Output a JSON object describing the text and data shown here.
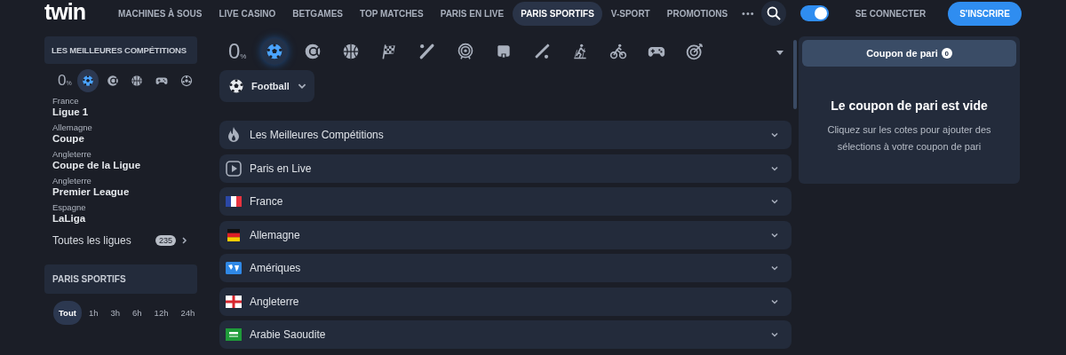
{
  "header": {
    "logo": "twin",
    "nav": [
      {
        "label": "MACHINES À SOUS",
        "selected": false
      },
      {
        "label": "LIVE CASINO",
        "selected": false
      },
      {
        "label": "BETGAMES",
        "selected": false
      },
      {
        "label": "TOP MATCHES",
        "selected": false
      },
      {
        "label": "PARIS EN LIVE",
        "selected": false
      },
      {
        "label": "PARIS SPORTIFS",
        "selected": true
      },
      {
        "label": "V-SPORT",
        "selected": false
      },
      {
        "label": "PROMOTIONS",
        "selected": false
      }
    ],
    "more": "•••",
    "dark_mode": {
      "on": true
    },
    "login": "SE CONNECTER",
    "signup": "S'INSCRIRE"
  },
  "sidebar": {
    "title": "LES MEILLEURES COMPÉTITIONS",
    "sports": [
      {
        "kind": "zero",
        "digit": "0",
        "sign": "%",
        "selected": false
      },
      {
        "kind": "football",
        "selected": true
      },
      {
        "kind": "tennis",
        "selected": false
      },
      {
        "kind": "basketball",
        "selected": false
      },
      {
        "kind": "gamepad",
        "selected": false
      },
      {
        "kind": "ball",
        "selected": false
      }
    ],
    "leagues": [
      {
        "country": "France",
        "name": "Ligue 1"
      },
      {
        "country": "Allemagne",
        "name": "Coupe"
      },
      {
        "country": "Angleterre",
        "name": "Coupe de la Ligue"
      },
      {
        "country": "Angleterre",
        "name": "Premier League"
      },
      {
        "country": "Espagne",
        "name": "LaLiga"
      }
    ],
    "all_leagues": {
      "label": "Toutes les ligues",
      "count": "235"
    },
    "section": "PARIS SPORTIFS",
    "time_filters": [
      {
        "label": "Tout",
        "selected": true
      },
      {
        "label": "1h",
        "selected": false
      },
      {
        "label": "3h",
        "selected": false
      },
      {
        "label": "6h",
        "selected": false
      },
      {
        "label": "12h",
        "selected": false
      },
      {
        "label": "24h",
        "selected": false
      }
    ]
  },
  "main": {
    "sports": [
      {
        "kind": "zero",
        "digit": "0",
        "sign": "%",
        "selected": false
      },
      {
        "kind": "football",
        "selected": true
      },
      {
        "kind": "tennis",
        "selected": false
      },
      {
        "kind": "basketball",
        "selected": false
      },
      {
        "kind": "flag",
        "selected": false
      },
      {
        "kind": "baseball",
        "selected": false
      },
      {
        "kind": "target",
        "selected": false
      },
      {
        "kind": "boxing",
        "selected": false
      },
      {
        "kind": "cricket",
        "selected": false
      },
      {
        "kind": "skiing",
        "selected": false
      },
      {
        "kind": "cycling",
        "selected": false
      },
      {
        "kind": "gamepad",
        "selected": false
      },
      {
        "kind": "darts",
        "selected": false
      }
    ],
    "sport_select": {
      "label": "Football"
    },
    "categories": [
      {
        "kind": "fire",
        "label": "Les Meilleures Compétitions"
      },
      {
        "kind": "live",
        "label": "Paris en Live"
      },
      {
        "kind": "fr",
        "label": "France"
      },
      {
        "kind": "de",
        "label": "Allemagne"
      },
      {
        "kind": "world",
        "label": "Amériques"
      },
      {
        "kind": "en",
        "label": "Angleterre"
      },
      {
        "kind": "sa",
        "label": "Arabie Saoudite"
      }
    ]
  },
  "coupon": {
    "tab": "Coupon de pari",
    "count": "0",
    "title": "Le coupon de pari est vide",
    "text": "Cliquez sur les cotes pour ajouter des sélections à votre coupon de pari"
  }
}
